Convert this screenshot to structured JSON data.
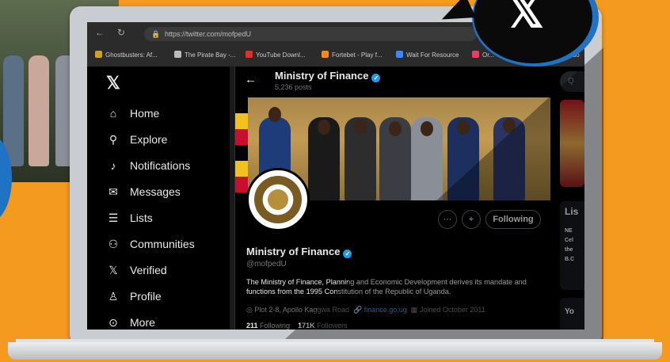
{
  "browser": {
    "url": "https://twitter.com/mofpedU",
    "bookmarks": [
      {
        "label": "Ghostbusters: Af...",
        "color": "#c9a227"
      },
      {
        "label": "The Pirate Bay -...",
        "color": "#bbbbbb"
      },
      {
        "label": "YouTube Downl...",
        "color": "#d9342b"
      },
      {
        "label": "Fortebet - Play f...",
        "color": "#f08a24"
      },
      {
        "label": "Wait For Resource",
        "color": "#4285f4"
      },
      {
        "label": "Or...",
        "color": "#e4405f"
      },
      {
        "label": "Vendo",
        "color": "#1d9bf0"
      }
    ]
  },
  "sidebar": {
    "logo": "𝕏",
    "items": [
      {
        "label": "Home",
        "icon": "home-icon"
      },
      {
        "label": "Explore",
        "icon": "search-icon"
      },
      {
        "label": "Notifications",
        "icon": "bell-icon"
      },
      {
        "label": "Messages",
        "icon": "envelope-icon"
      },
      {
        "label": "Lists",
        "icon": "list-icon"
      },
      {
        "label": "Communities",
        "icon": "communities-icon"
      },
      {
        "label": "Verified",
        "icon": "x-verified-icon"
      },
      {
        "label": "Profile",
        "icon": "person-icon"
      },
      {
        "label": "More",
        "icon": "more-circle-icon"
      }
    ]
  },
  "profile": {
    "header_name": "Ministry of Finance",
    "header_posts": "5,236 posts",
    "name": "Ministry of Finance",
    "handle": "@mofpedU",
    "bio": "The Ministry of Finance, Planning and Economic Development derives its mandate and functions from the 1995 Constitution of the Republic of Uganda.",
    "location": "Plot 2-8, Apollo Kaggwa Road",
    "website": "finance.go.ug",
    "joined": "Joined October 2011",
    "following_count": "211",
    "following_label": "Following",
    "followers_count": "171K",
    "followers_label": "Followers",
    "follow_button": "Following",
    "more_button": "···",
    "notify_button": "+"
  },
  "right": {
    "search_placeholder": "Q",
    "box_title": "Lis",
    "box_lines": [
      "NE",
      "Cel",
      "the",
      "B.C"
    ],
    "box2_title": "Yo"
  },
  "colors": {
    "accent": "#1d9bf0",
    "background": "#f39a1f",
    "brand_blue": "#1e73c4"
  }
}
